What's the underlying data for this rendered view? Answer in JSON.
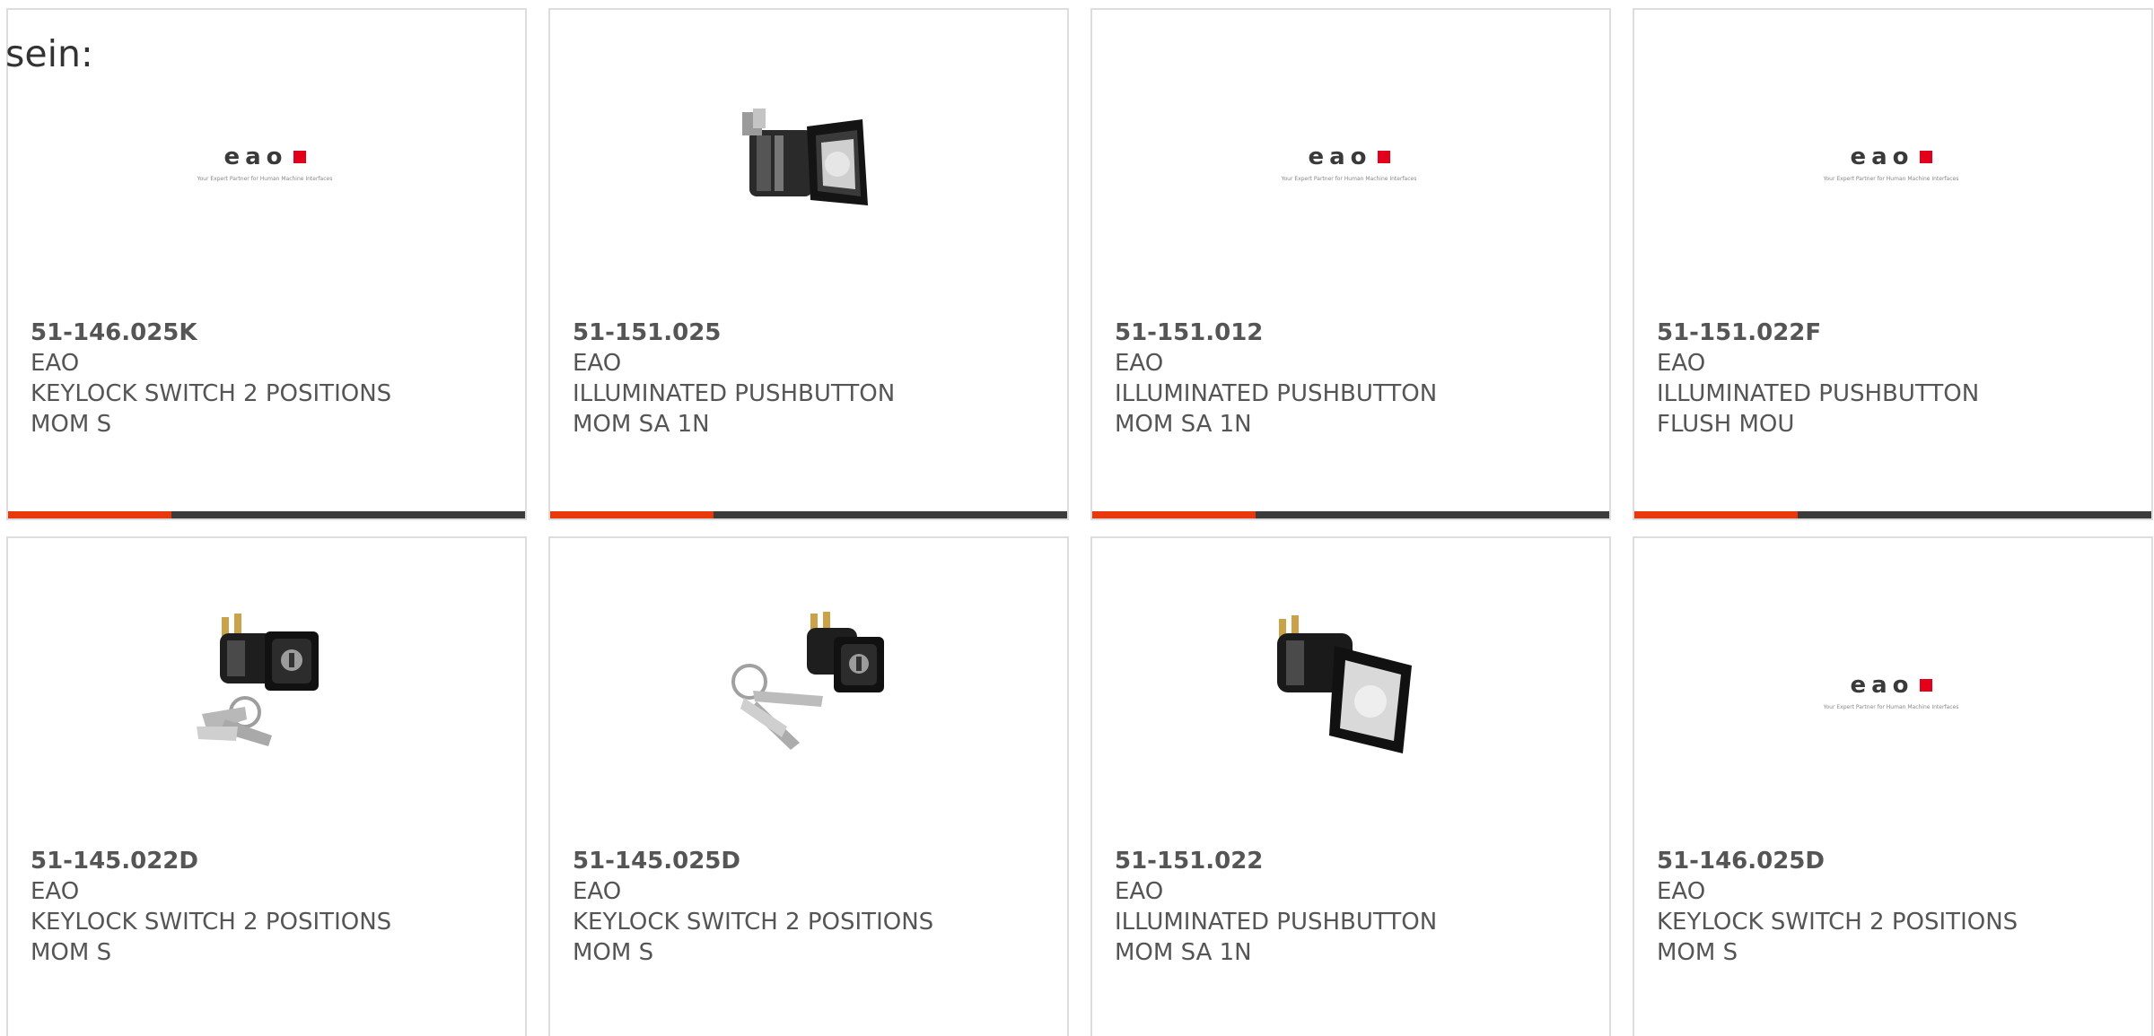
{
  "intro": "sein:",
  "colors": {
    "accent": "#e8380d",
    "bar": "#3b3b3b",
    "brand_red": "#e2001a"
  },
  "logo": {
    "text": "eao",
    "tagline": "Your Expert Partner for Human Machine Interfaces"
  },
  "products": [
    {
      "part": "51-146.025K",
      "brand": "EAO",
      "desc1": "KEYLOCK SWITCH 2 POSITIONS",
      "desc2": "MOM S",
      "image": "eao-logo"
    },
    {
      "part": "51-151.025",
      "brand": "EAO",
      "desc1": "ILLUMINATED PUSHBUTTON",
      "desc2": "MOM SA 1N",
      "image": "illuminated-pushbutton-photo"
    },
    {
      "part": "51-151.012",
      "brand": "EAO",
      "desc1": "ILLUMINATED PUSHBUTTON",
      "desc2": "MOM SA 1N",
      "image": "eao-logo"
    },
    {
      "part": "51-151.022F",
      "brand": "EAO",
      "desc1": "ILLUMINATED PUSHBUTTON",
      "desc2": "FLUSH MOU",
      "image": "eao-logo"
    },
    {
      "part": "51-145.022D",
      "brand": "EAO",
      "desc1": "KEYLOCK SWITCH 2 POSITIONS",
      "desc2": "MOM S",
      "image": "keylock-switch-photo"
    },
    {
      "part": "51-145.025D",
      "brand": "EAO",
      "desc1": "KEYLOCK SWITCH 2 POSITIONS",
      "desc2": "MOM S",
      "image": "keylock-switch-photo"
    },
    {
      "part": "51-151.022",
      "brand": "EAO",
      "desc1": "ILLUMINATED PUSHBUTTON",
      "desc2": "MOM SA 1N",
      "image": "illuminated-pushbutton-photo"
    },
    {
      "part": "51-146.025D",
      "brand": "EAO",
      "desc1": "KEYLOCK SWITCH 2 POSITIONS",
      "desc2": "MOM S",
      "image": "eao-logo"
    }
  ]
}
